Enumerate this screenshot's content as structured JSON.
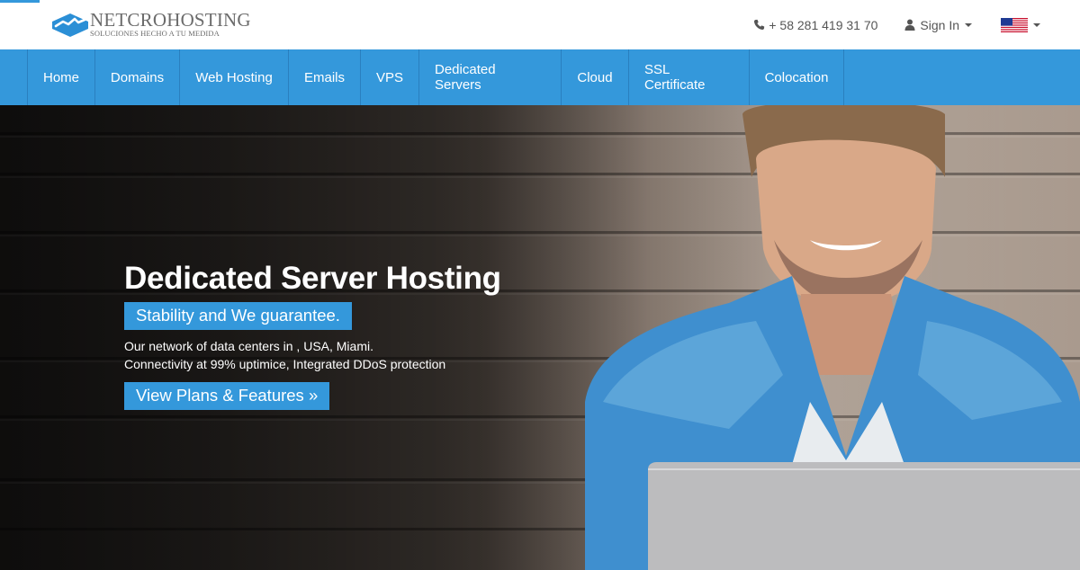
{
  "brand": {
    "name": "NETCROHOSTING",
    "tagline": "SOLUCIONES HECHO A TU MEDIDA",
    "accent_color": "#3498db",
    "logo_icon": "cloud-chart-logo-icon"
  },
  "topbar": {
    "phone_icon": "phone-icon",
    "phone": "+ 58 281 419 31 70",
    "signin_icon": "user-icon",
    "signin_label": "Sign In",
    "language_flag": "us-flag-icon"
  },
  "nav": {
    "items": [
      {
        "label": "Home"
      },
      {
        "label": "Domains"
      },
      {
        "label": "Web Hosting"
      },
      {
        "label": "Emails"
      },
      {
        "label": "VPS"
      },
      {
        "label": "Dedicated Servers"
      },
      {
        "label": "Cloud"
      },
      {
        "label": "SSL Certificate"
      },
      {
        "label": "Colocation"
      }
    ]
  },
  "hero": {
    "title": "Dedicated Server Hosting",
    "badge": "Stability and We guarantee.",
    "line1": "Our network of data centers in , USA, Miami.",
    "line2": "Connectivity at 99% uptimice, Integrated DDoS protection",
    "cta_label": "View Plans & Features »",
    "image": "smiling-man-with-laptop-on-stairs"
  }
}
